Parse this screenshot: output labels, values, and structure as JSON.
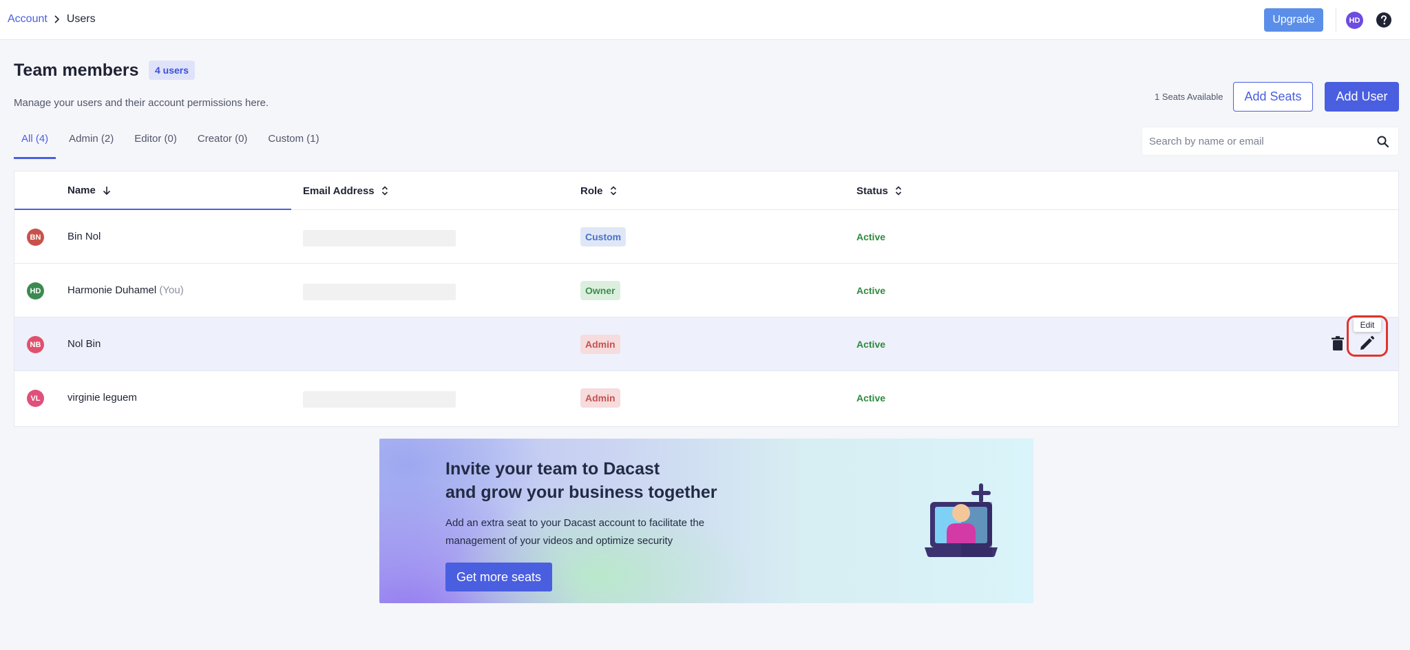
{
  "breadcrumb": {
    "parent": "Account",
    "current": "Users"
  },
  "topbar": {
    "upgrade_label": "Upgrade",
    "avatar_initials": "HD"
  },
  "header": {
    "title": "Team members",
    "count_badge": "4 users",
    "subtitle": "Manage your users and their account permissions here.",
    "seats_available": "1 Seats Available",
    "add_seats_label": "Add Seats",
    "add_user_label": "Add User"
  },
  "tabs": [
    {
      "label": "All (4)",
      "active": true
    },
    {
      "label": "Admin (2)",
      "active": false
    },
    {
      "label": "Editor (0)",
      "active": false
    },
    {
      "label": "Creator (0)",
      "active": false
    },
    {
      "label": "Custom (1)",
      "active": false
    }
  ],
  "search": {
    "placeholder": "Search by name or email"
  },
  "table": {
    "columns": [
      "Name",
      "Email Address",
      "Role",
      "Status"
    ],
    "rows": [
      {
        "initials": "BN",
        "avatar_color": "#c8524b",
        "name": "Bin Nol",
        "you": "",
        "role": "Custom",
        "status": "Active"
      },
      {
        "initials": "HD",
        "avatar_color": "#3c8a50",
        "name": "Harmonie Duhamel",
        "you": "(You)",
        "role": "Owner",
        "status": "Active"
      },
      {
        "initials": "NB",
        "avatar_color": "#e0506e",
        "name": "Nol Bin",
        "you": "",
        "role": "Admin",
        "status": "Active"
      },
      {
        "initials": "VL",
        "avatar_color": "#e0507a",
        "name": "virginie leguem",
        "you": "",
        "role": "Admin",
        "status": "Active"
      }
    ],
    "edit_tooltip": "Edit"
  },
  "banner": {
    "title_line1": "Invite your team to Dacast",
    "title_line2": "and grow your business together",
    "text": "Add an extra seat to your Dacast account to facilitate the management of your videos and optimize security",
    "cta_label": "Get more seats"
  },
  "colors": {
    "accent": "#4a5ee0",
    "status_active": "#2e8a3e",
    "highlight_ring": "#e0342b"
  }
}
